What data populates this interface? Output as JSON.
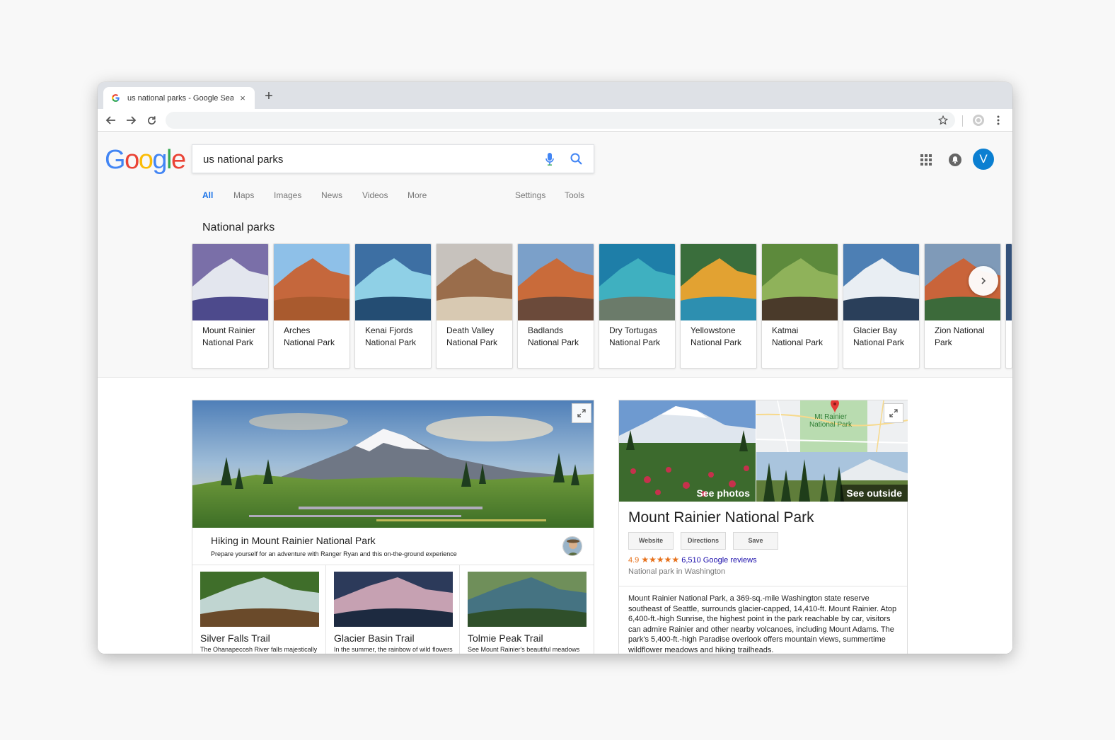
{
  "browser": {
    "tab_title": "us national parks - Google Sear",
    "close_glyph": "×",
    "new_tab_glyph": "+"
  },
  "google": {
    "logo_letters": [
      "G",
      "o",
      "o",
      "g",
      "l",
      "e"
    ],
    "logo_colors": [
      "#4285F4",
      "#EA4335",
      "#FBBC05",
      "#4285F4",
      "#34A853",
      "#EA4335"
    ],
    "query": "us national parks",
    "avatar_letter": "V",
    "avatar_color": "#0b7fd1"
  },
  "search_tabs": [
    {
      "label": "All",
      "active": true
    },
    {
      "label": "Maps"
    },
    {
      "label": "Images"
    },
    {
      "label": "News"
    },
    {
      "label": "Videos"
    },
    {
      "label": "More"
    },
    {
      "label": "Settings"
    },
    {
      "label": "Tools"
    }
  ],
  "national_parks": {
    "title": "National parks",
    "items": [
      {
        "line1": "Mount Rainier",
        "line2": "National Park"
      },
      {
        "line1": "Arches",
        "line2": "National Park"
      },
      {
        "line1": "Kenai Fjords",
        "line2": "National Park"
      },
      {
        "line1": "Death Valley",
        "line2": "National Park"
      },
      {
        "line1": "Badlands",
        "line2": "National Park"
      },
      {
        "line1": "Dry Tortugas",
        "line2": "National Park"
      },
      {
        "line1": "Yellowstone",
        "line2": "National Park"
      },
      {
        "line1": "Katmai",
        "line2": "National Park"
      },
      {
        "line1": "Glacier Bay",
        "line2": "National Park"
      },
      {
        "line1": "Zion National",
        "line2": "Park"
      }
    ]
  },
  "hiking": {
    "title": "Hiking in Mount Rainier National Park",
    "subtitle": "Prepare yourself for an adventure with Ranger Ryan and this on-the-ground experience",
    "trails": [
      {
        "name": "Silver Falls Trail",
        "desc": "The Ohanapecosh River falls majestically"
      },
      {
        "name": "Glacier Basin Trail",
        "desc": "In the summer, the rainbow of wild flowers"
      },
      {
        "name": "Tolmie Peak Trail",
        "desc": "See Mount Rainier's beautiful meadows"
      }
    ]
  },
  "knowledge_panel": {
    "see_photos": "See photos",
    "see_outside": "See outside",
    "map_label_1": "Mt Rainier",
    "map_label_2": "National Park",
    "title": "Mount Rainier National Park",
    "buttons": [
      "Website",
      "Directions",
      "Save"
    ],
    "rating": "4.9",
    "stars": "★★★★★",
    "reviews": "6,510 Google reviews",
    "type": "National park in Washington",
    "description": "Mount Rainier National Park, a 369-sq.-mile Washington state reserve southeast of Seattle, surrounds glacier-capped, 14,410-ft. Mount Rainier. Atop 6,400-ft.-high Sunrise, the highest point in the park reachable by car, visitors can admire Rainier and other nearby volcanoes, including Mount Adams. The park's 5,400-ft.-high Paradise overlook offers mountain views, summertime wildflower meadows and hiking trailheads."
  }
}
